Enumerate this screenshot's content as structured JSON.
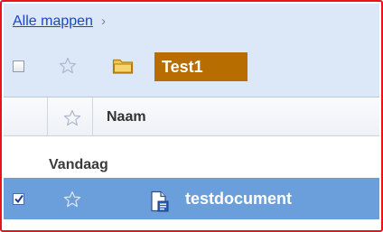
{
  "breadcrumb": {
    "link_label": "Alle mappen",
    "separator": "›"
  },
  "folder": {
    "title": "Test1",
    "icon": "folder-icon",
    "checked": false,
    "starred": false
  },
  "columns": {
    "name_label": "Naam"
  },
  "groups": [
    {
      "label": "Vandaag",
      "rows": [
        {
          "title": "testdocument",
          "icon": "document-icon",
          "checked": true,
          "starred": false
        }
      ]
    }
  ],
  "colors": {
    "frame_border": "#e8141b",
    "header_bg": "#dce8f7",
    "link": "#1a47c6",
    "folder_highlight": "#b86d00",
    "selected_row": "#6b9fdc"
  }
}
